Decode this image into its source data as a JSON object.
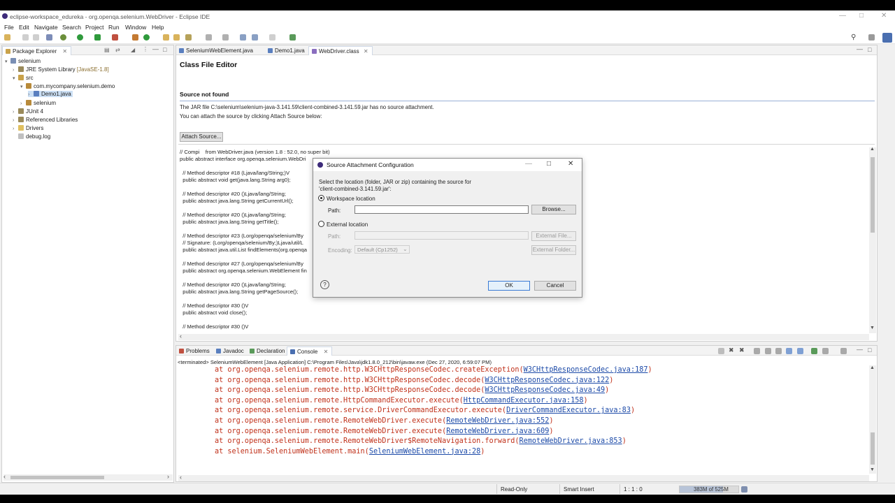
{
  "window": {
    "title": "eclipse-workspace_edureka - org.openqa.selenium.WebDriver - Eclipse IDE"
  },
  "menu": [
    "File",
    "Edit",
    "Navigate",
    "Search",
    "Project",
    "Run",
    "Window",
    "Help"
  ],
  "package_explorer": {
    "title": "Package Explorer",
    "items": [
      {
        "label": "selenium",
        "extra": ""
      },
      {
        "label": "JRE System Library ",
        "extra": "[JavaSE-1.8]"
      },
      {
        "label": "src",
        "extra": ""
      },
      {
        "label": "com.mycompany.selenium.demo",
        "extra": ""
      },
      {
        "label": "Demo1.java",
        "extra": ""
      },
      {
        "label": "selenium",
        "extra": ""
      },
      {
        "label": "JUnit 4",
        "extra": ""
      },
      {
        "label": "Referenced Libraries",
        "extra": ""
      },
      {
        "label": "Drivers",
        "extra": ""
      },
      {
        "label": "debug.log",
        "extra": ""
      }
    ]
  },
  "editor": {
    "tabs": [
      "SeleniumWebElement.java",
      "Demo1.java",
      "WebDriver.class"
    ],
    "heading": "Class File Editor",
    "source_not_found": "Source not found",
    "jar_msg": "The JAR file C:\\selenium\\selenium-java-3.141.59\\client-combined-3.141.59.jar has no source attachment.",
    "attach_msg": "You can attach the source by clicking Attach Source below:",
    "attach_button": "Attach Source...",
    "code_lines": [
      "// Compi    from WebDriver.java (version 1.8 : 52.0, no super bit)",
      "public abstract interface org.openqa.selenium.WebDri",
      "",
      "  // Method descriptor #18 (Ljava/lang/String;)V",
      "  public abstract void get(java.lang.String arg0);",
      "",
      "  // Method descriptor #20 ()Ljava/lang/String;",
      "  public abstract java.lang.String getCurrentUrl();",
      "",
      "  // Method descriptor #20 ()Ljava/lang/String;",
      "  public abstract java.lang.String getTitle();",
      "",
      "  // Method descriptor #23 (Lorg/openqa/selenium/By",
      "  // Signature: (Lorg/openqa/selenium/By;)Ljava/util/L",
      "  public abstract java.util.List findElements(org.openqa",
      "",
      "  // Method descriptor #27 (Lorg/openqa/selenium/By",
      "  public abstract org.openqa.selenium.WebElement fin",
      "",
      "  // Method descriptor #20 ()Ljava/lang/String;",
      "  public abstract java.lang.String getPageSource();",
      "",
      "  // Method descriptor #30 ()V",
      "  public abstract void close();",
      "",
      "  // Method descriptor #30 ()V"
    ]
  },
  "dialog": {
    "title": "Source Attachment Configuration",
    "desc_line1": "Select the location (folder, JAR or zip) containing the source for",
    "desc_line2": "'client-combined-3.141.59.jar':",
    "workspace_label": "Workspace location",
    "path_label": "Path:",
    "browse": "Browse...",
    "external_label": "External location",
    "path_label2": "Path:",
    "external_file": "External File...",
    "encoding_label": "Encoding:",
    "encoding_value": "Default (Cp1252)",
    "external_folder": "External Folder...",
    "ok": "OK",
    "cancel": "Cancel",
    "help": "?"
  },
  "bottom": {
    "tabs": [
      "Problems",
      "Javadoc",
      "Declaration",
      "Console"
    ],
    "terminated": "<terminated> SeleniumWebElement [Java Application] C:\\Program Files\\Java\\jdk1.8.0_212\\bin\\javaw.exe  (Dec 27, 2020, 6:59:07 PM)",
    "lines": [
      {
        "text": "at org.openqa.selenium.remote.http.W3CHttpResponseCodec.createException(",
        "link": "W3CHttpResponseCodec.java:187",
        "end": ")"
      },
      {
        "text": "at org.openqa.selenium.remote.http.W3CHttpResponseCodec.decode(",
        "link": "W3CHttpResponseCodec.java:122",
        "end": ")"
      },
      {
        "text": "at org.openqa.selenium.remote.http.W3CHttpResponseCodec.decode(",
        "link": "W3CHttpResponseCodec.java:49",
        "end": ")"
      },
      {
        "text": "at org.openqa.selenium.remote.HttpCommandExecutor.execute(",
        "link": "HttpCommandExecutor.java:158",
        "end": ")"
      },
      {
        "text": "at org.openqa.selenium.remote.service.DriverCommandExecutor.execute(",
        "link": "DriverCommandExecutor.java:83",
        "end": ")"
      },
      {
        "text": "at org.openqa.selenium.remote.RemoteWebDriver.execute(",
        "link": "RemoteWebDriver.java:552",
        "end": ")"
      },
      {
        "text": "at org.openqa.selenium.remote.RemoteWebDriver.execute(",
        "link": "RemoteWebDriver.java:609",
        "end": ")"
      },
      {
        "text": "at org.openqa.selenium.remote.RemoteWebDriver$RemoteNavigation.forward(",
        "link": "RemoteWebDriver.java:853",
        "end": ")"
      },
      {
        "text": "at selenium.SeleniumWebElement.main(",
        "link": "SeleniumWebElement.java:28",
        "end": ")"
      }
    ]
  },
  "status": {
    "mode": "Read-Only",
    "insert": "Smart Insert",
    "pos": "1 : 1 : 0",
    "heap": "383M of 525M"
  },
  "colors": {
    "accent": "#1c4aa8",
    "error": "#c0311a",
    "selection": "#cce0f5"
  }
}
